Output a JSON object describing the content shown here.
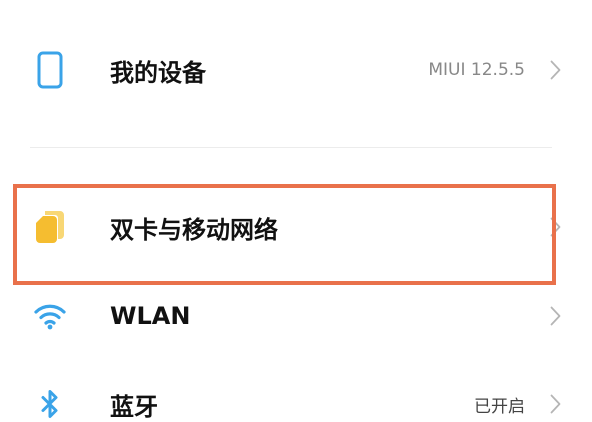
{
  "settings": {
    "my_device": {
      "label": "我的设备",
      "value": "MIUI 12.5.5"
    },
    "dual_sim": {
      "label": "双卡与移动网络"
    },
    "wlan": {
      "label": "WLAN"
    },
    "bluetooth": {
      "label": "蓝牙",
      "value": "已开启"
    }
  },
  "icons": {
    "my_device": "phone-icon",
    "dual_sim": "sim-card-icon",
    "wlan": "wifi-icon",
    "bluetooth": "bluetooth-icon",
    "chevron": "chevron-right-icon"
  },
  "colors": {
    "icon_blue": "#3aa3e8",
    "sim_yellow": "#f5bd30",
    "highlight": "#e9714b",
    "label": "#111111",
    "value": "#888888"
  }
}
